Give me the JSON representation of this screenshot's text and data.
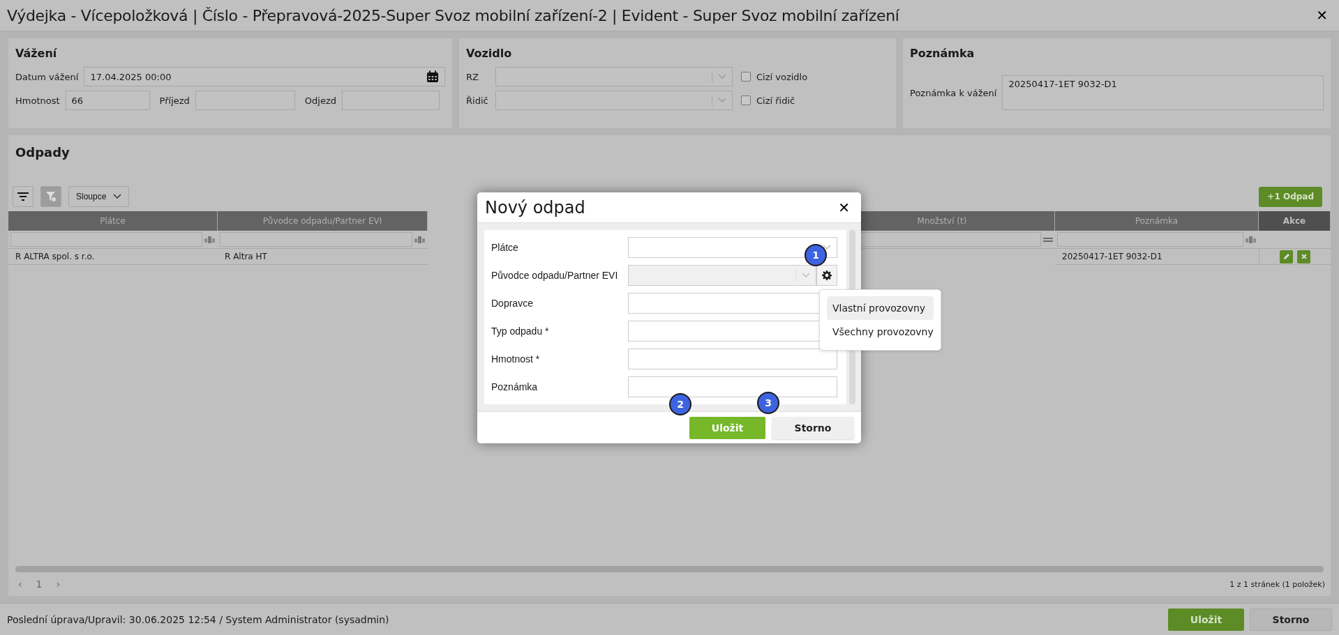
{
  "window": {
    "title": "Výdejka - Vícepoložková | Číslo - Přepravová-2025-Super Svoz mobilní zařízení-2 | Evident - Super Svoz mobilní zařízení",
    "close": "✕"
  },
  "vazeni": {
    "heading": "Vážení",
    "datum_label": "Datum vážení",
    "datum_value": "17.04.2025 00:00",
    "hmotnost_label": "Hmotnost",
    "hmotnost_value": "66",
    "prijezd_label": "Příjezd",
    "odjezd_label": "Odjezd"
  },
  "vozidlo": {
    "heading": "Vozidlo",
    "rows": [
      {
        "label": "RZ",
        "checkbox": "Cizí vozidlo",
        "checked": false
      },
      {
        "label": "Řidič",
        "checkbox": "Cizí řidič",
        "checked": false
      }
    ]
  },
  "poznamka": {
    "heading": "Poznámka",
    "label": "Poznámka k vážení",
    "value": "20250417-1ET 9032-D1"
  },
  "odpady": {
    "heading": "Odpady",
    "columns_button": "Sloupce",
    "add_button": "+1 Odpad",
    "columns": [
      {
        "label": "Plátce",
        "kind": "text"
      },
      {
        "label": "Původce odpadu/Partner EVI",
        "kind": "text"
      },
      {
        "label": "Množství (t)",
        "kind": "number"
      },
      {
        "label": "Poznámka",
        "kind": "text"
      },
      {
        "label": "Akce",
        "kind": "actions"
      }
    ],
    "rows": [
      {
        "platce": "R ALTRA spol. s r.o.",
        "puvodce": "R Altra HT",
        "poznamka": "20250417-1ET 9032-D1"
      }
    ],
    "pager": {
      "prev": "‹",
      "page": "1",
      "next": "›",
      "summary": "1 z 1 stránek (1 položek)"
    }
  },
  "footer": {
    "text": "Poslední úprava/Upravil: 30.06.2025 12:54 / System Administrator (sysadmin)",
    "save": "Uložit",
    "cancel": "Storno"
  },
  "modal": {
    "title": "Nový odpad",
    "close": "✕",
    "fields": [
      {
        "label": "Plátce",
        "kind": "select",
        "disabled": false
      },
      {
        "label": "Původce odpadu/Partner EVI",
        "kind": "select-gear",
        "disabled": true
      },
      {
        "label": "Dopravce",
        "kind": "lookup",
        "disabled": false
      },
      {
        "label": "Typ odpadu *",
        "kind": "lookup",
        "disabled": false
      },
      {
        "label": "Hmotnost *",
        "kind": "input",
        "disabled": false
      },
      {
        "label": "Poznámka",
        "kind": "input",
        "disabled": false
      }
    ],
    "menu": [
      {
        "label": "Vlastní provozovny",
        "selected": true
      },
      {
        "label": "Všechny provozovny",
        "selected": false
      }
    ],
    "save": "Uložit",
    "cancel": "Storno",
    "badges": [
      {
        "number": "1",
        "kind": "gear"
      },
      {
        "number": "2",
        "kind": "save"
      },
      {
        "number": "3",
        "kind": "cancel"
      }
    ]
  }
}
